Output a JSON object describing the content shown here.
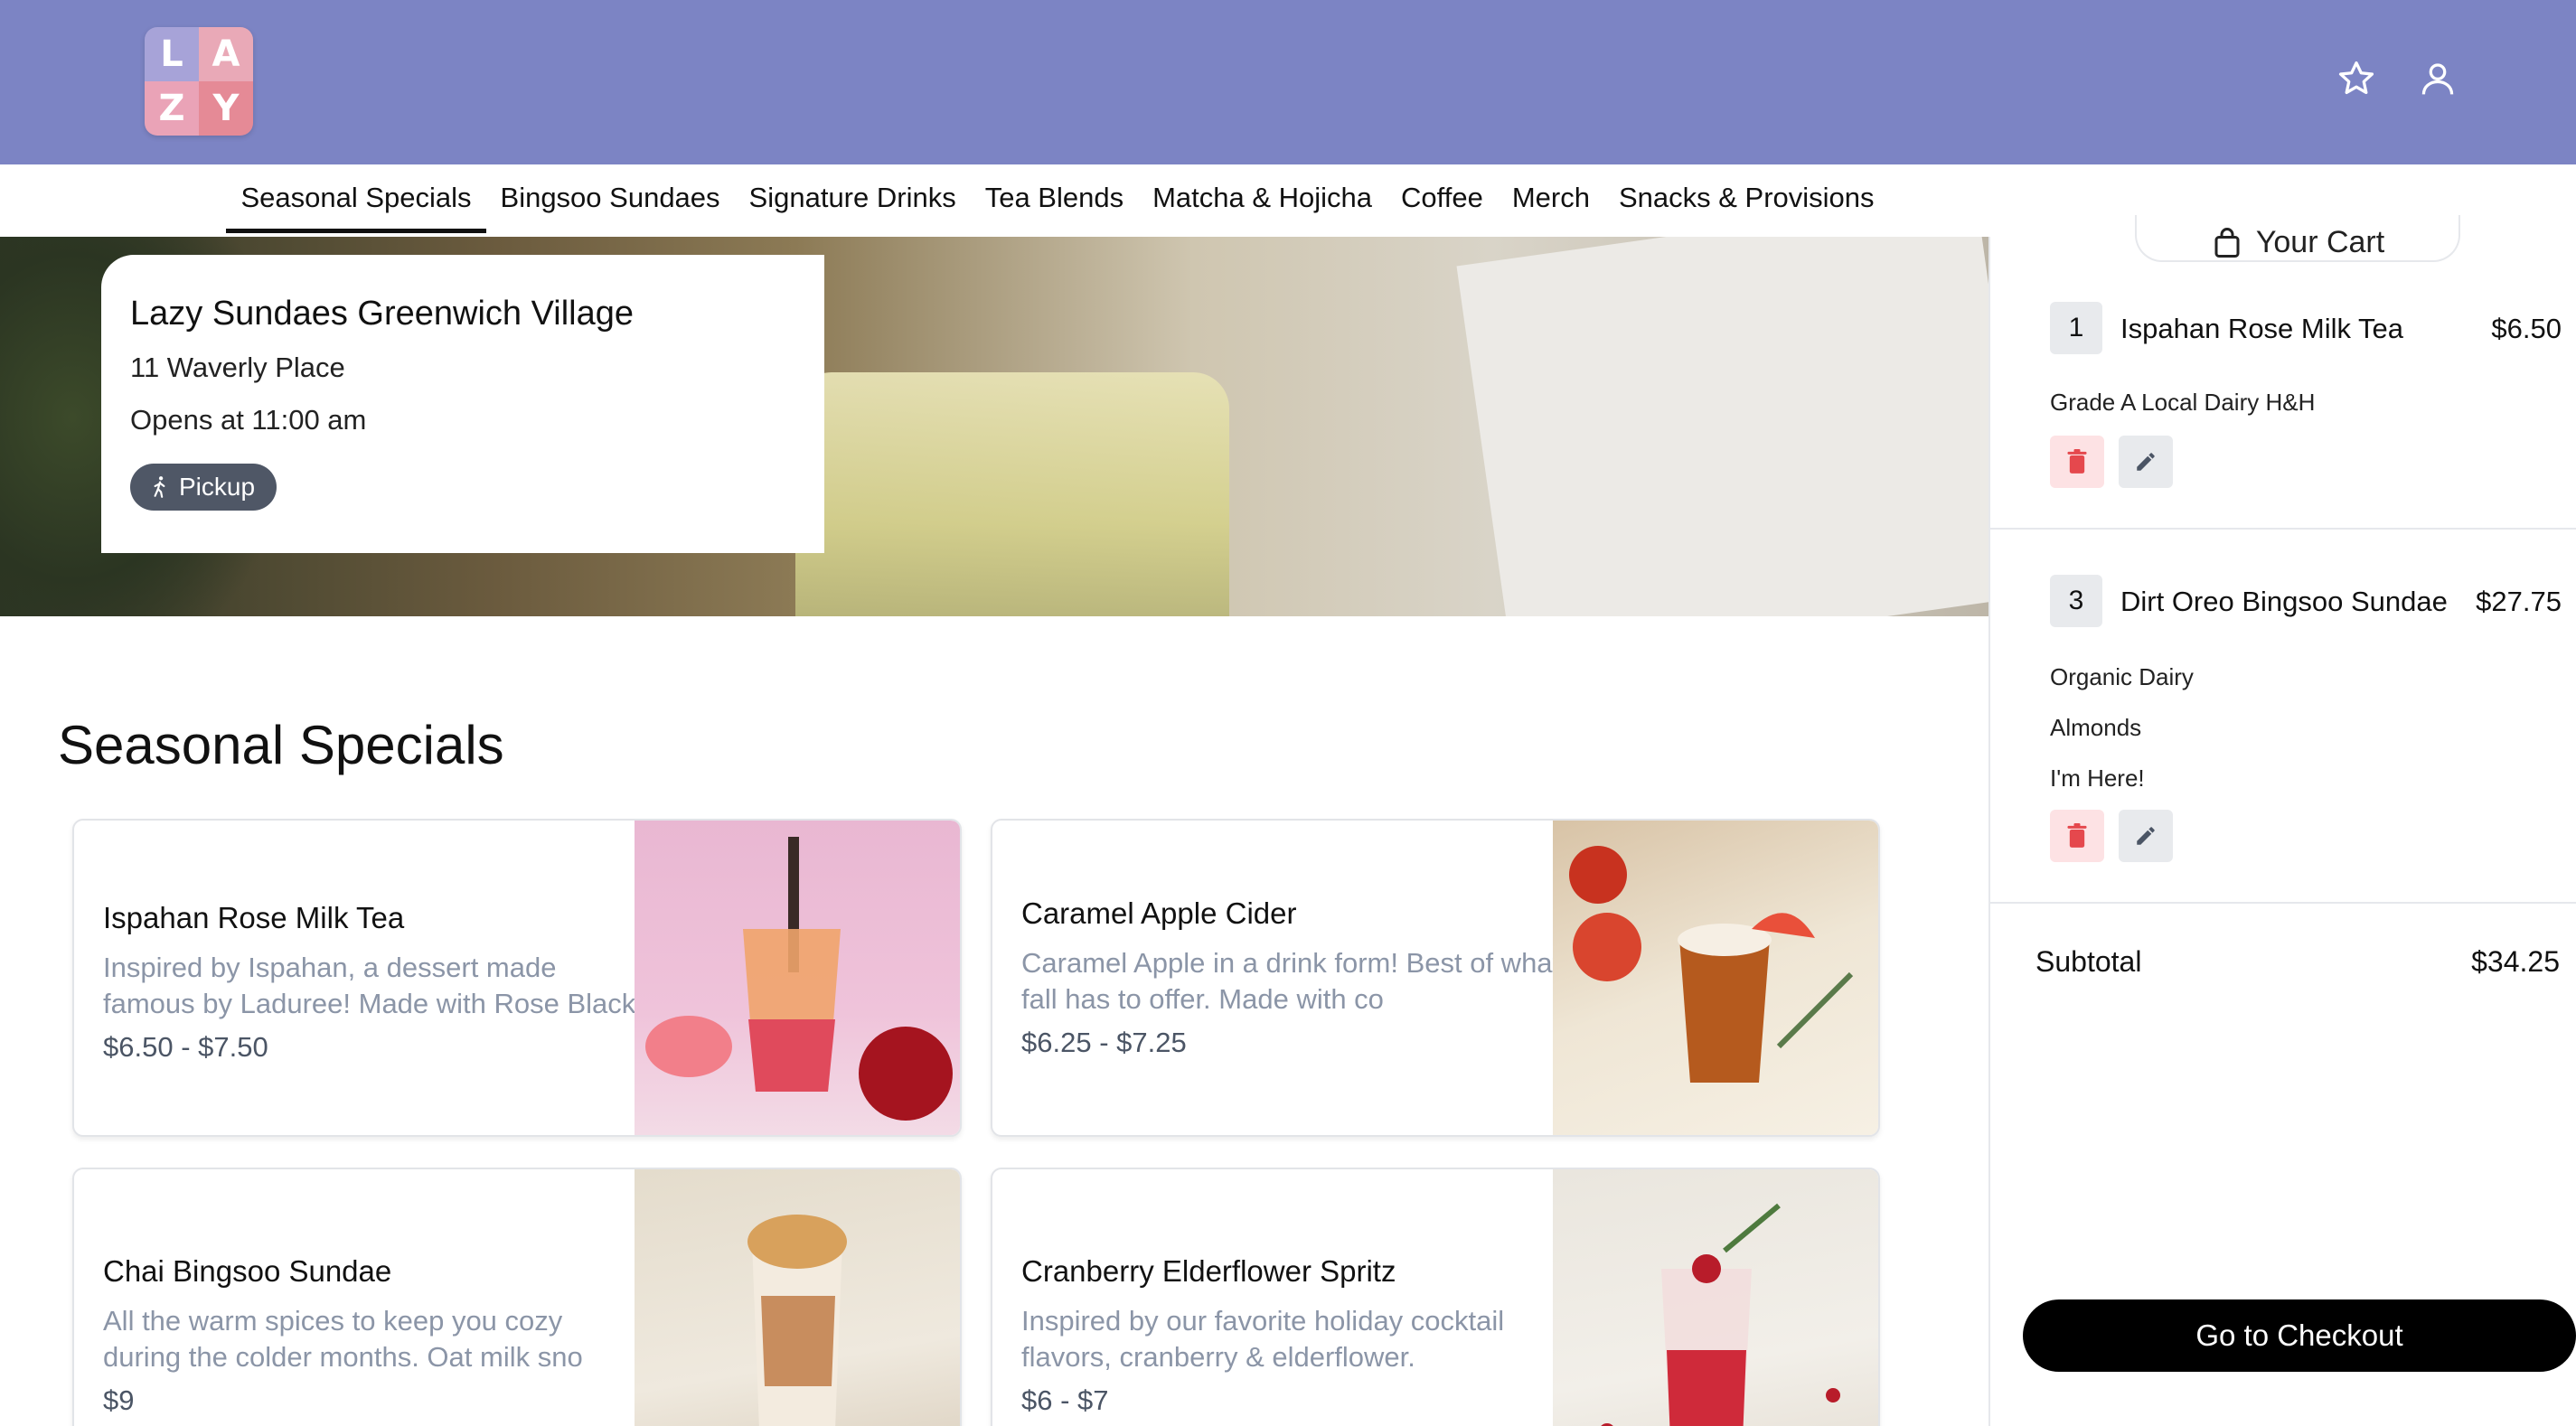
{
  "header": {
    "logo_letters": [
      "L",
      "A",
      "Z",
      "Y"
    ],
    "icons": [
      "star-icon",
      "user-icon"
    ]
  },
  "nav": {
    "tabs": [
      {
        "label": "Seasonal Specials",
        "active": true
      },
      {
        "label": "Bingsoo Sundaes"
      },
      {
        "label": "Signature Drinks"
      },
      {
        "label": "Tea Blends"
      },
      {
        "label": "Matcha & Hojicha"
      },
      {
        "label": "Coffee"
      },
      {
        "label": "Merch"
      },
      {
        "label": "Snacks & Provisions"
      }
    ]
  },
  "store": {
    "name": "Lazy Sundaes Greenwich Village",
    "address": "11 Waverly Place",
    "hours": "Opens at 11:00 am",
    "mode": "Pickup"
  },
  "section": {
    "title": "Seasonal Specials"
  },
  "products": [
    {
      "name": "Ispahan Rose Milk Tea",
      "description": "Inspired by Ispahan, a dessert made famous by Laduree! Made with Rose Black",
      "price": "$6.50 - $7.50"
    },
    {
      "name": "Caramel Apple Cider",
      "description": "Caramel Apple in a drink form! Best of what fall has to offer. Made with co",
      "price": "$6.25 - $7.25"
    },
    {
      "name": "Chai Bingsoo Sundae",
      "description": "All the warm spices to keep you cozy during the colder months. Oat milk sno",
      "price": "$9"
    },
    {
      "name": "Cranberry Elderflower Spritz",
      "description": "Inspired by our favorite holiday cocktail flavors, cranberry & elderflower.",
      "price": "$6 - $7"
    }
  ],
  "cart": {
    "title": "Your Cart",
    "items": [
      {
        "qty": "1",
        "name": "Ispahan Rose Milk Tea",
        "price": "$6.50",
        "options": [
          "Grade A Local Dairy H&H"
        ]
      },
      {
        "qty": "3",
        "name": "Dirt Oreo Bingsoo Sundae",
        "price": "$27.75",
        "options": [
          "Organic Dairy",
          "Almonds",
          "I'm Here!"
        ]
      }
    ],
    "subtotal_label": "Subtotal",
    "subtotal_value": "$34.25",
    "checkout_label": "Go to Checkout"
  },
  "colors": {
    "header_bg": "#7c84c4",
    "pill_bg": "#4f5766",
    "delete_bg": "#fde2e4",
    "delete_icon": "#e5484d",
    "checkout_bg": "#000000"
  }
}
